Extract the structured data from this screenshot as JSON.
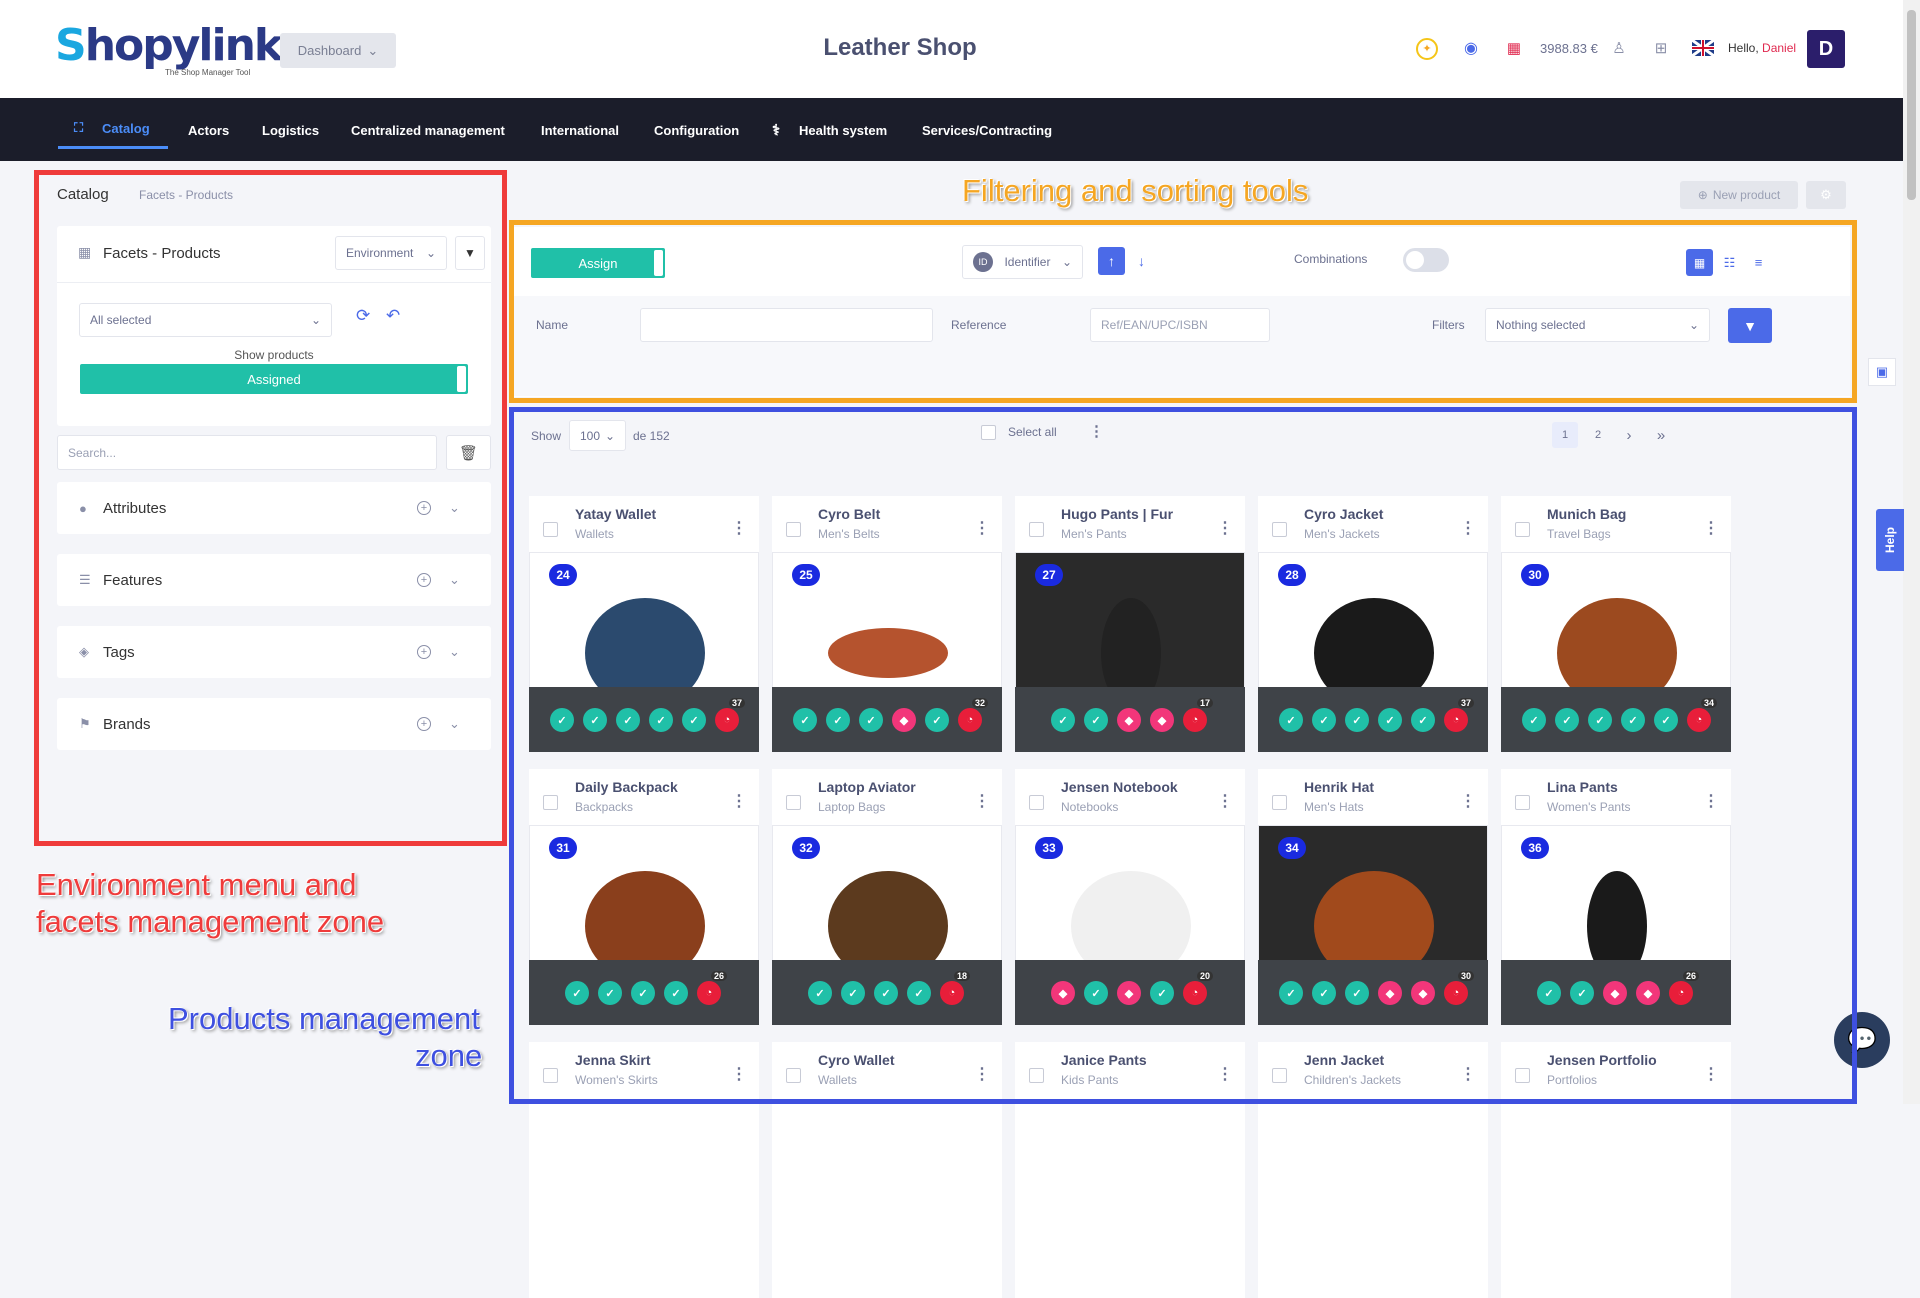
{
  "header": {
    "logo_text": "Shopylinker",
    "logo_tagline": "The Shop Manager Tool",
    "dashboard_label": "Dashboard",
    "shop_title": "Leather Shop",
    "balance": "3988.83 €",
    "hello_label": "Hello,",
    "user_name": "Daniel",
    "avatar_initial": "D"
  },
  "nav": {
    "items": [
      "Catalog",
      "Actors",
      "Logistics",
      "Centralized management",
      "International",
      "Configuration",
      "Health system",
      "Services/Contracting"
    ]
  },
  "breadcrumb": {
    "root": "Catalog",
    "current": "Facets - Products"
  },
  "top_actions": {
    "new_product": "New product"
  },
  "facets_panel": {
    "title": "Facets - Products",
    "environment_label": "Environment",
    "all_selected": "All selected",
    "show_products_label": "Show products",
    "assigned_label": "Assigned",
    "search_placeholder": "Search...",
    "sections": [
      "Attributes",
      "Features",
      "Tags",
      "Brands"
    ]
  },
  "filter_panel": {
    "assign_label": "Assign",
    "identifier_label": "Identifier",
    "id_badge": "ID",
    "combinations_label": "Combinations",
    "name_label": "Name",
    "reference_label": "Reference",
    "reference_placeholder": "Ref/EAN/UPC/ISBN",
    "filters_label": "Filters",
    "filters_value": "Nothing selected"
  },
  "list_controls": {
    "show_label": "Show",
    "page_size": "100",
    "total_label": "de 152",
    "select_all_label": "Select all",
    "pages": [
      "1",
      "2"
    ]
  },
  "products": [
    {
      "name": "Yatay Wallet",
      "category": "Wallets",
      "id": "24",
      "count": "37"
    },
    {
      "name": "Cyro Belt",
      "category": "Men's Belts",
      "id": "25",
      "count": "32"
    },
    {
      "name": "Hugo Pants | Fur",
      "category": "Men's Pants",
      "id": "27",
      "count": "17"
    },
    {
      "name": "Cyro Jacket",
      "category": "Men's Jackets",
      "id": "28",
      "count": "37"
    },
    {
      "name": "Munich Bag",
      "category": "Travel Bags",
      "id": "30",
      "count": "34"
    },
    {
      "name": "Daily Backpack",
      "category": "Backpacks",
      "id": "31",
      "count": "26"
    },
    {
      "name": "Laptop Aviator",
      "category": "Laptop Bags",
      "id": "32",
      "count": "18"
    },
    {
      "name": "Jensen Notebook",
      "category": "Notebooks",
      "id": "33",
      "count": "20"
    },
    {
      "name": "Henrik Hat",
      "category": "Men's Hats",
      "id": "34",
      "count": "30"
    },
    {
      "name": "Lina Pants",
      "category": "Women's Pants",
      "id": "36",
      "count": "26"
    },
    {
      "name": "Jenna Skirt",
      "category": "Women's Skirts",
      "id": "",
      "count": ""
    },
    {
      "name": "Cyro Wallet",
      "category": "Wallets",
      "id": "",
      "count": ""
    },
    {
      "name": "Janice Pants",
      "category": "Kids Pants",
      "id": "",
      "count": ""
    },
    {
      "name": "Jenn Jacket",
      "category": "Children's Jackets",
      "id": "",
      "count": ""
    },
    {
      "name": "Jensen Portfolio",
      "category": "Portfolios",
      "id": "",
      "count": ""
    }
  ],
  "annotations": {
    "filter_zone": "Filtering and sorting tools",
    "env_zone_1": "Environment menu and",
    "env_zone_2": "facets management zone",
    "prod_zone_1": "Products management",
    "prod_zone_2": "zone"
  },
  "help_label": "Help",
  "colors": {
    "accent_blue": "#4b6ae8",
    "teal": "#20c0a8",
    "navbar": "#1b1d2a",
    "annotation_red": "#ef3b3b",
    "annotation_orange": "#f5a623",
    "annotation_blue": "#3e50e0"
  }
}
